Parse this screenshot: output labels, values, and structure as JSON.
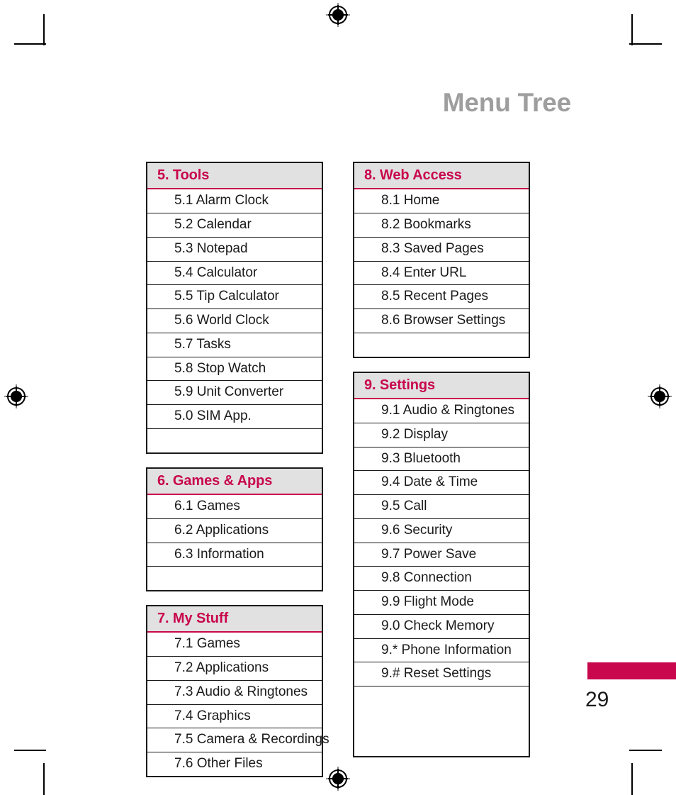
{
  "page": {
    "title": "Menu Tree",
    "number": "29",
    "accent_color": "#c8074c",
    "header_bg_color": "#e1e1e1",
    "title_color": "#9e9e9e"
  },
  "marks": {
    "registration_icon": "registration-target-icon",
    "crop_mark": "crop-mark"
  },
  "columns": [
    {
      "name": "left",
      "sections": [
        {
          "header": "5. Tools",
          "items": [
            "5.1 Alarm Clock",
            "5.2 Calendar",
            "5.3 Notepad",
            "5.4 Calculator",
            "5.5 Tip Calculator",
            "5.6 World Clock",
            "5.7 Tasks",
            "5.8 Stop Watch",
            "5.9 Unit Converter",
            "5.0 SIM App."
          ],
          "filler_rows": 1
        },
        {
          "header": "6. Games & Apps",
          "items": [
            "6.1 Games",
            "6.2 Applications",
            "6.3 Information"
          ],
          "filler_rows": 1
        },
        {
          "header": "7. My Stuff",
          "items": [
            "7.1 Games",
            "7.2 Applications",
            "7.3 Audio & Ringtones",
            "7.4 Graphics",
            "7.5 Camera & Recordings",
            "7.6 Other Files"
          ],
          "filler_rows": 0
        }
      ]
    },
    {
      "name": "right",
      "sections": [
        {
          "header": "8. Web Access",
          "items": [
            "8.1 Home",
            "8.2 Bookmarks",
            "8.3 Saved Pages",
            "8.4 Enter URL",
            "8.5 Recent Pages",
            "8.6 Browser Settings"
          ],
          "filler_rows": 1
        },
        {
          "header": "9. Settings",
          "items": [
            "9.1 Audio & Ringtones",
            "9.2 Display",
            "9.3 Bluetooth",
            "9.4 Date & Time",
            "9.5 Call",
            "9.6 Security",
            "9.7 Power Save",
            "9.8 Connection",
            "9.9 Flight Mode",
            "9.0 Check Memory",
            "9.* Phone Information",
            "9.# Reset Settings"
          ],
          "filler_rows": 3
        }
      ]
    }
  ]
}
